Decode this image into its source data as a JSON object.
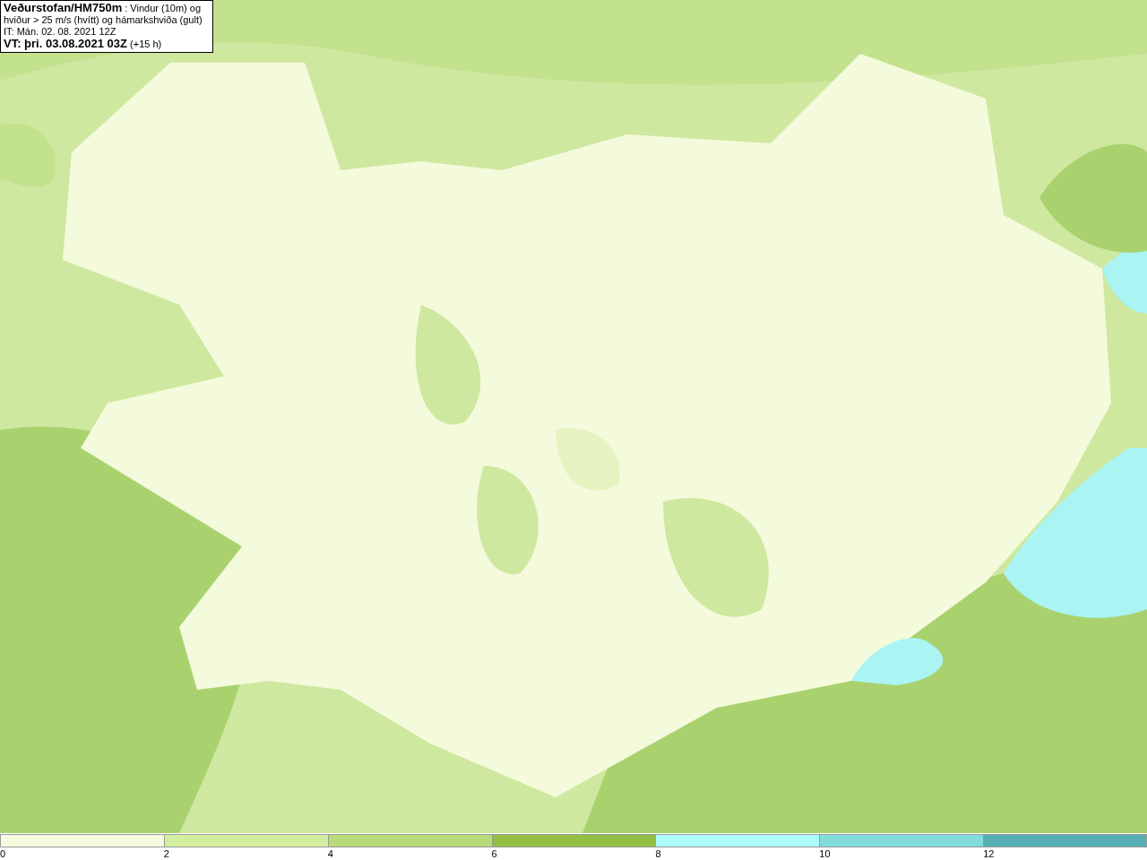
{
  "info_box": {
    "lines": [
      "**Veðurstofan/HM750m** : Vindur (10m) og hviður > 25 m/s (hvítt) og hámarkshviða (gult)",
      "IT: Mán. 02. 08. 2021 12Z",
      "**VT: þri. 03.08.2021 03Z** (+15 h)"
    ]
  },
  "legend": [
    {
      "label": "0",
      "color": "#f4fbdf"
    },
    {
      "label": "2",
      "color": "#d4eea0"
    },
    {
      "label": "4",
      "color": "#b6db78"
    },
    {
      "label": "6",
      "color": "#94bf45"
    },
    {
      "label": "8",
      "color": "#aefcfb"
    },
    {
      "label": "10",
      "color": "#82dcdc"
    },
    {
      "label": "12",
      "color": "#55b0b3"
    }
  ]
}
